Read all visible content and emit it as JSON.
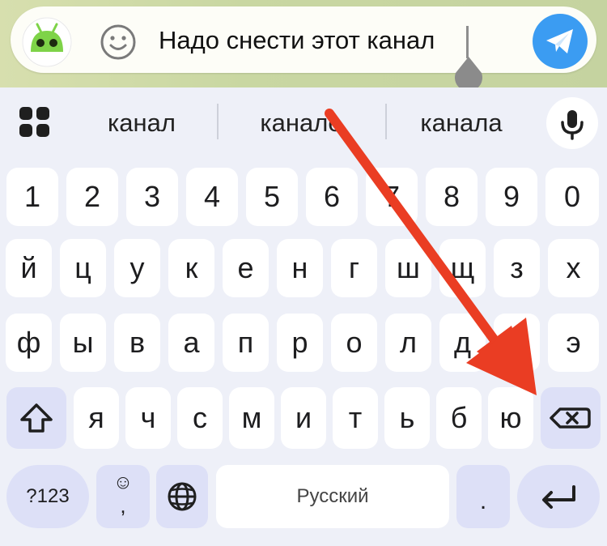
{
  "input": {
    "text": "Надо снести этот канал"
  },
  "icons": {
    "app": "android-robot-icon",
    "emoji": "smiley-icon",
    "send": "paper-plane-icon",
    "grid": "app-grid-icon",
    "mic": "microphone-icon",
    "shift": "shift-icon",
    "backspace": "backspace-icon",
    "globe": "globe-icon",
    "enter": "enter-icon"
  },
  "suggestions": [
    "канал",
    "канале",
    "канала"
  ],
  "keyboard": {
    "number_row": [
      "1",
      "2",
      "3",
      "4",
      "5",
      "6",
      "7",
      "8",
      "9",
      "0"
    ],
    "row1": [
      "й",
      "ц",
      "у",
      "к",
      "е",
      "н",
      "г",
      "ш",
      "щ",
      "з",
      "х"
    ],
    "row2": [
      "ф",
      "ы",
      "в",
      "а",
      "п",
      "р",
      "о",
      "л",
      "д",
      "ж",
      "э"
    ],
    "row3": [
      "я",
      "ч",
      "с",
      "м",
      "и",
      "т",
      "ь",
      "б",
      "ю"
    ],
    "symbols_label": "?123",
    "emoji_top": "☺",
    "emoji_bottom": ",",
    "space_label": "Русский",
    "period_label": "."
  },
  "colors": {
    "send_button": "#3b9cf2",
    "arrow": "#ea3d23",
    "function_key": "#dde0f7",
    "app_icon": "#7ed348"
  }
}
